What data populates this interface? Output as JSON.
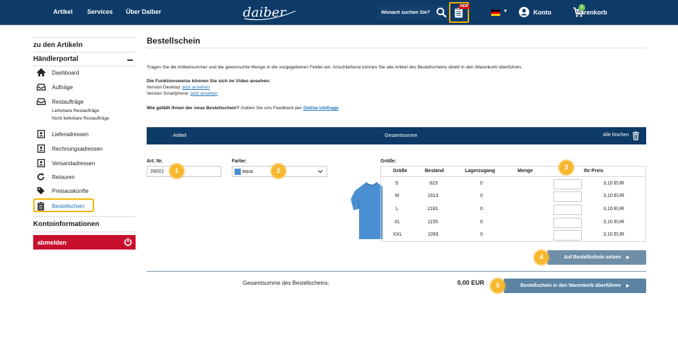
{
  "header": {
    "nav": [
      "Artikel",
      "Services",
      "Über Daiber"
    ],
    "logo": "daiber",
    "search_placeholder": "Wonach suchen Sie?",
    "new_badge": "NEW",
    "account": "Konto",
    "cart": "Warenkorb",
    "cart_count": "1",
    "colors": {
      "bar": "#0d3a66",
      "highlight": "#f4b400"
    }
  },
  "sidebar": {
    "back_link": "zu den Artikeln",
    "section": "Händlerportal",
    "items": [
      {
        "label": "Dashboard",
        "icon": "home-icon"
      },
      {
        "label": "Aufträge",
        "icon": "inbox-icon"
      },
      {
        "label": "Restaufträge",
        "icon": "inbox-icon"
      },
      {
        "label": "Lieferadressen",
        "icon": "contact-card-icon"
      },
      {
        "label": "Rechnungsadressen",
        "icon": "contact-card-icon"
      },
      {
        "label": "Versandadressen",
        "icon": "contact-card-icon"
      },
      {
        "label": "Retouren",
        "icon": "return-icon"
      },
      {
        "label": "Preisauskünfte",
        "icon": "price-tag-icon"
      },
      {
        "label": "Bestellschein",
        "icon": "clipboard-icon"
      }
    ],
    "sub_items": [
      "Lieferbare Restaufträge",
      "Nicht lieferbare Restaufträge"
    ],
    "account_section": "Kontoinformationen",
    "logout": "abmelden"
  },
  "main": {
    "title": "Bestellschein",
    "intro": "Tragen Sie die Artikelnummer und die gewünschte Menge in die vorgegebenen Felder ein. Anschließend können Sie alle Artikel des Bestellscheins direkt in den Warenkorb überführen.",
    "how_title": "Die Funktionsweise können Sie sich im Video ansehen:",
    "how_desktop": "Version Desktop:",
    "how_phone": "Version Smartphone:",
    "watch_link": "jetzt ansehen",
    "feedback_q": "Wie gefällt Ihnen der neue Bestellschein?",
    "feedback_text": "Geben Sie uns Feedback per",
    "feedback_link": "Online-Umfrage",
    "table_header": {
      "article": "Artikel",
      "sum": "Gesamtsumme",
      "delete_all": "Alle löschen"
    },
    "art_nr_label": "Art. Nr.",
    "art_nr_value": "JN001",
    "color_label": "Farbe:",
    "color_value": "aqua",
    "size_label": "Größe:",
    "size_columns": [
      "Größe",
      "Bestand",
      "Lagerzugang",
      "Menge",
      "Ihr Preis"
    ],
    "sizes": [
      {
        "size": "S",
        "stock": "823",
        "incoming": "0",
        "price": "3,10 EUR"
      },
      {
        "size": "M",
        "stock": "1613",
        "incoming": "0",
        "price": "3,10 EUR"
      },
      {
        "size": "L",
        "stock": "2181",
        "incoming": "0",
        "price": "3,10 EUR"
      },
      {
        "size": "XL",
        "stock": "1155",
        "incoming": "0",
        "price": "3,10 EUR"
      },
      {
        "size": "XXL",
        "stock": "1093",
        "incoming": "0",
        "price": "3,10 EUR"
      }
    ],
    "add_button": "Auf Bestellschein setzen",
    "total_label": "Gesamtsumme des Bestellscheins:",
    "total_value": "0,00 EUR",
    "transfer_button": "Bestellschein in den Warenkorb überführen",
    "step_badges": [
      "1",
      "2",
      "3",
      "4",
      "5"
    ]
  }
}
